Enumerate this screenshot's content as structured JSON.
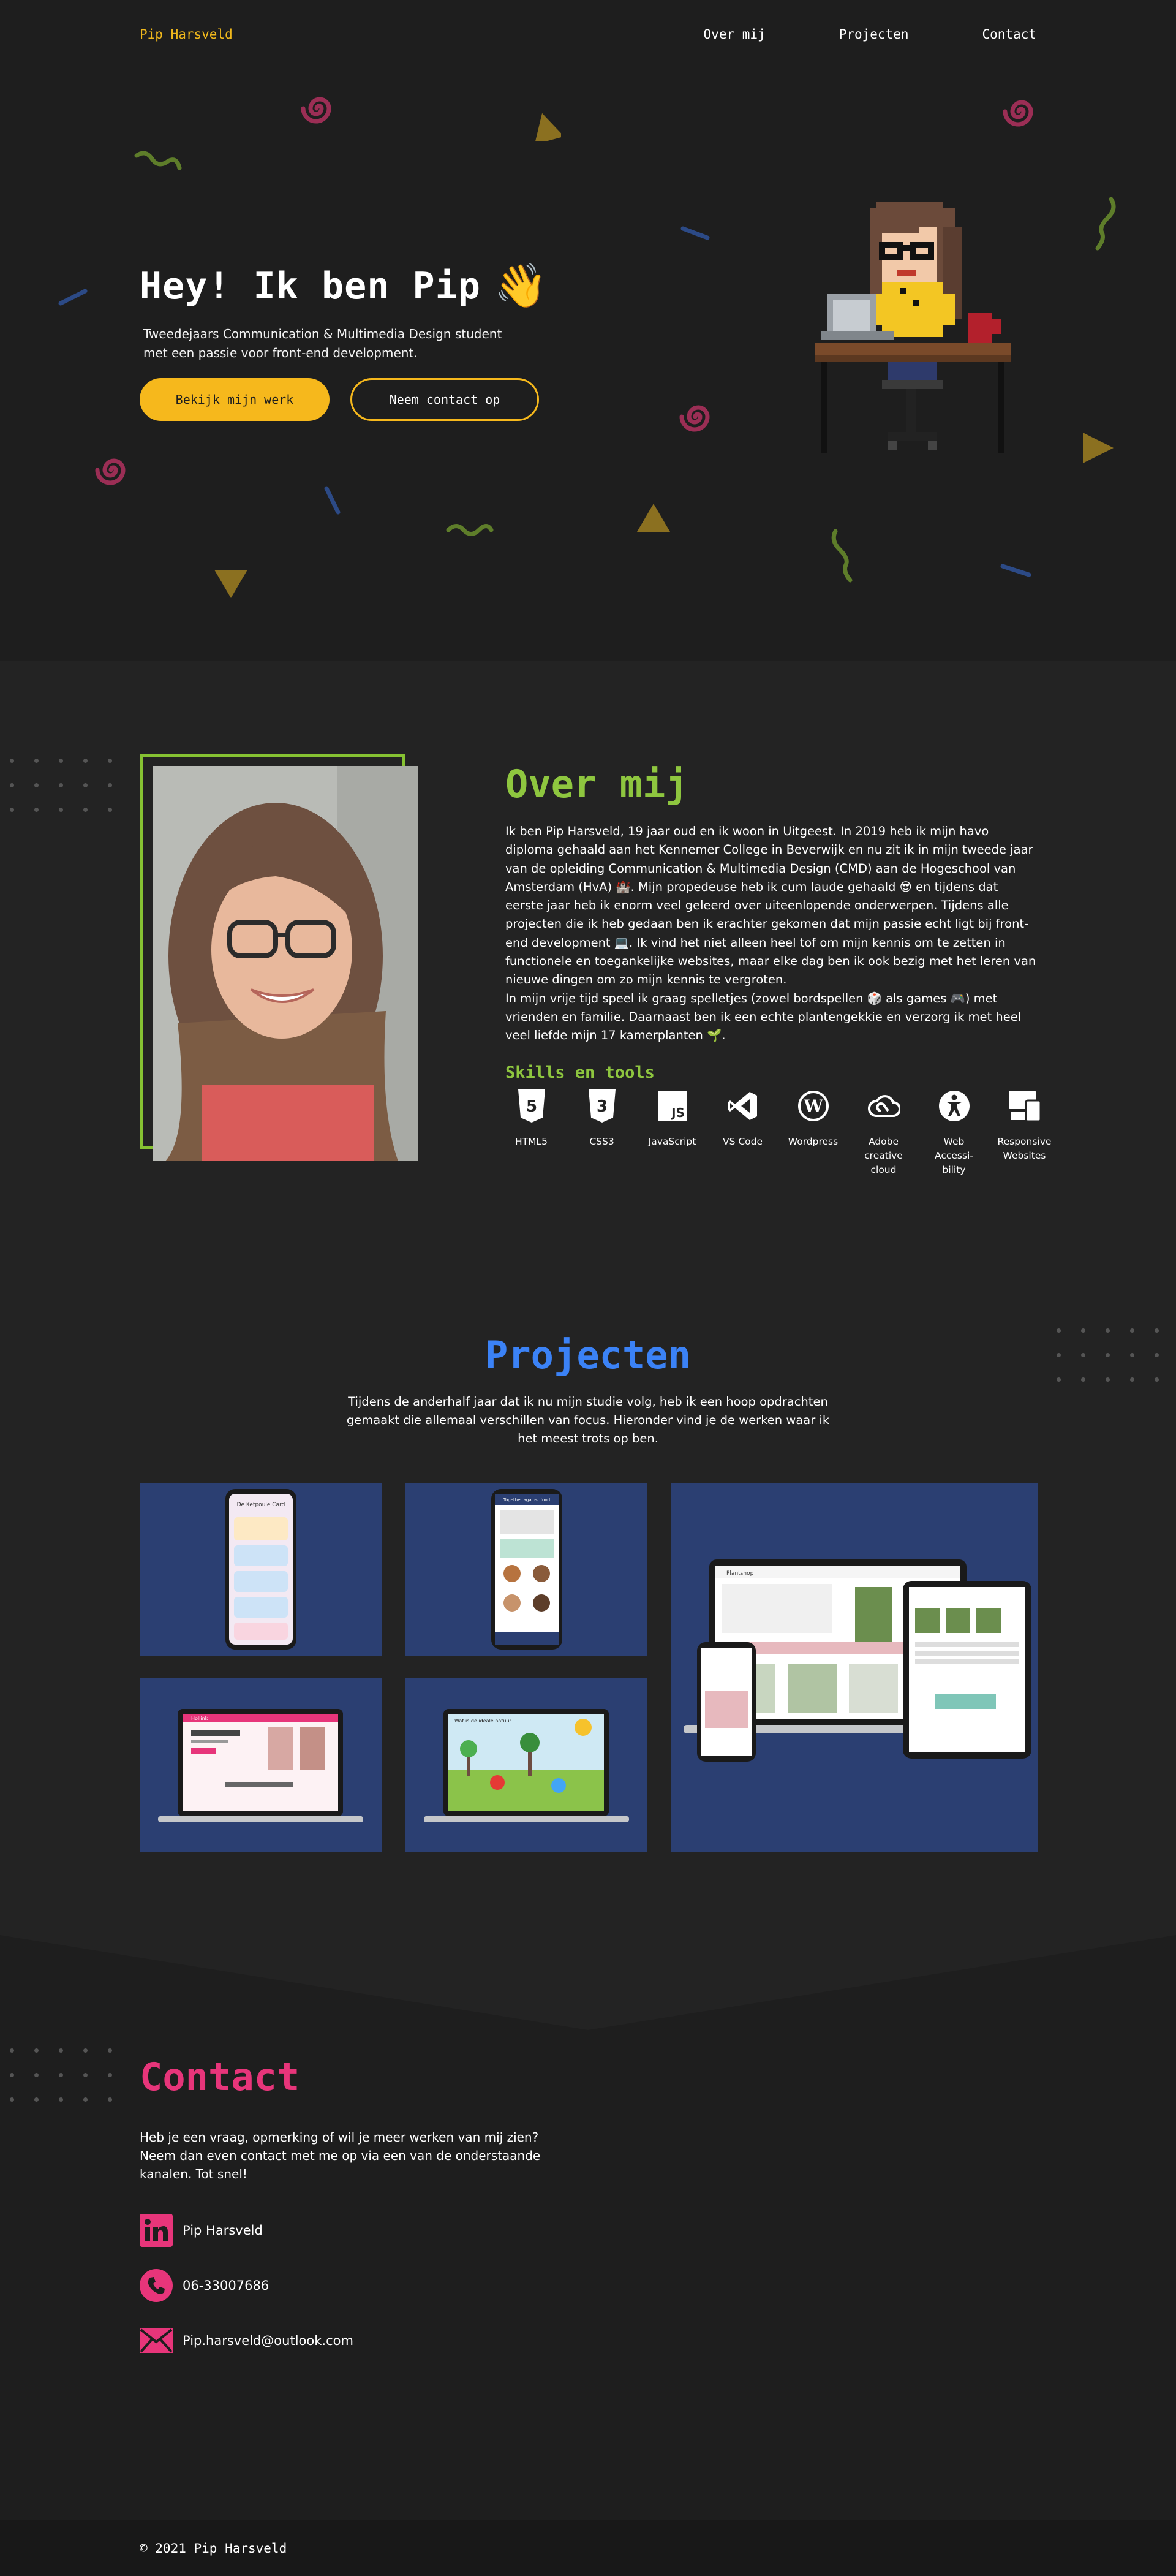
{
  "nav": {
    "logo": "Pip Harsveld",
    "links": [
      "Over mij",
      "Projecten",
      "Contact"
    ]
  },
  "hero": {
    "title": "Hey! Ik ben Pip",
    "wave_emoji": "👋",
    "subtitle": "Tweedejaars Communication & Multimedia Design student met een passie voor front-end development.",
    "primary_button": "Bekijk mijn werk",
    "secondary_button": "Neem contact op"
  },
  "about": {
    "title": "Over mij",
    "paragraph_1": "Ik ben Pip Harsveld, 19 jaar oud en ik woon in Uitgeest. In 2019 heb ik mijn havo diploma gehaald aan het Kennemer College in Beverwijk en nu zit ik in mijn tweede jaar van de opleiding Communication & Multimedia Design (CMD) aan de Hogeschool van Amsterdam (HvA) 🏰. Mijn propedeuse heb ik cum laude gehaald 😎 en tijdens dat eerste jaar heb ik enorm veel geleerd over uiteenlopende onderwerpen. Tijdens alle projecten die ik heb gedaan ben ik erachter gekomen dat mijn passie echt ligt bij front-end development 💻. Ik vind het niet alleen heel tof om mijn kennis om te zetten in functionele en toegankelijke websites, maar elke dag ben ik ook bezig met het leren van nieuwe dingen om zo mijn kennis te vergroten.",
    "paragraph_2": "In mijn vrije tijd speel ik graag spelletjes (zowel bordspellen 🎲 als games 🎮) met vrienden en familie. Daarnaast ben ik een echte plantengekkie en verzorg ik met heel veel liefde mijn 17 kamerplanten 🌱.",
    "skills_title": "Skills en tools",
    "skills": [
      {
        "label": "HTML5",
        "icon": "html5-icon"
      },
      {
        "label": "CSS3",
        "icon": "css3-icon"
      },
      {
        "label": "JavaScript",
        "icon": "javascript-icon"
      },
      {
        "label": "VS Code",
        "icon": "vscode-icon"
      },
      {
        "label": "Wordpress",
        "icon": "wordpress-icon"
      },
      {
        "label": "Adobe creative cloud",
        "icon": "creative-cloud-icon"
      },
      {
        "label": "Web Accessi-bility",
        "icon": "accessibility-icon"
      },
      {
        "label": "Responsive Websites",
        "icon": "responsive-icon"
      }
    ]
  },
  "projects": {
    "title": "Projecten",
    "subtitle": "Tijdens de anderhalf jaar dat ik nu mijn studie volg, heb ik een hoop opdrachten gemaakt die allemaal verschillen van focus. Hieronder vind je de werken waar ik het meest trots op ben.",
    "cards": [
      {
        "screen_title": "De Ketpoule Card"
      },
      {
        "screen_title": "Together against food"
      },
      {
        "screen_title": "Plantshop"
      },
      {
        "screen_title": "Hollink"
      },
      {
        "screen_title": "Wat is de ideale natuur"
      }
    ]
  },
  "contact": {
    "title": "Contact",
    "text": "Heb je een vraag, opmerking of wil je meer werken van mij zien? Neem dan even contact met me op via een van de onderstaande kanalen. Tot snel!",
    "linkedin": "Pip Harsveld",
    "phone": "06-33007686",
    "email": "Pip.harsveld@outlook.com"
  },
  "footer": {
    "text": "© 2021 Pip Harsveld"
  },
  "colors": {
    "background": "#1e1e1e",
    "accent_yellow": "#f6b81c",
    "accent_green": "#8ec63f",
    "accent_blue": "#3b82f6",
    "accent_pink": "#e7357a",
    "card_blue": "#2b3f72"
  }
}
